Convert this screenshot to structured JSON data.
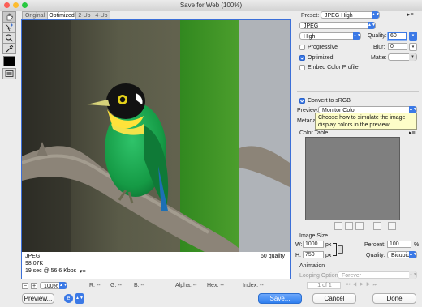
{
  "window": {
    "title": "Save for Web (100%)"
  },
  "tabs": [
    {
      "label": "Original"
    },
    {
      "label": "Optimized"
    },
    {
      "label": "2-Up"
    },
    {
      "label": "4-Up"
    }
  ],
  "preview": {
    "format": "JPEG",
    "size": "98.07K",
    "time": "19 sec @ 56.6 Kbps",
    "time_menu_icon": "menu-icon",
    "quality_label": "60 quality"
  },
  "settings": {
    "preset_label": "Preset:",
    "preset_value": "JPEG High",
    "format_value": "JPEG",
    "compression_value": "High",
    "quality_label": "Quality:",
    "quality_value": "60",
    "blur_label": "Blur:",
    "blur_value": "0",
    "matte_label": "Matte:",
    "progressive_label": "Progressive",
    "progressive_checked": false,
    "optimized_label": "Optimized",
    "optimized_checked": true,
    "embed_profile_label": "Embed Color Profile",
    "embed_profile_checked": false,
    "convert_srgb_label": "Convert to sRGB",
    "convert_srgb_checked": true,
    "preview_label": "Preview:",
    "preview_value": "Monitor Color",
    "metadata_label": "Metadata",
    "tooltip": "Choose how to simulate the image display colors in the preview"
  },
  "color_table": {
    "label": "Color Table"
  },
  "image_size": {
    "label": "Image Size",
    "w_label": "W:",
    "w_value": "1000",
    "h_label": "H:",
    "h_value": "750",
    "unit": "px",
    "percent_label": "Percent:",
    "percent_value": "100",
    "percent_unit": "%",
    "quality_label": "Quality:",
    "quality_value": "Bicubic"
  },
  "animation": {
    "label": "Animation",
    "looping_label": "Looping Options:",
    "looping_value": "Forever",
    "frame_counter": "1 of 1"
  },
  "statusbar": {
    "zoom": "100%",
    "r": "R: --",
    "g": "G: --",
    "b": "B: --",
    "alpha": "Alpha: --",
    "hex": "Hex: --",
    "index": "Index: --"
  },
  "footer": {
    "preview_button": "Preview...",
    "save_button": "Save...",
    "cancel_button": "Cancel",
    "done_button": "Done"
  },
  "colors": {
    "accent": "#3b79e6",
    "tooltip_bg": "#fdfdc8"
  }
}
